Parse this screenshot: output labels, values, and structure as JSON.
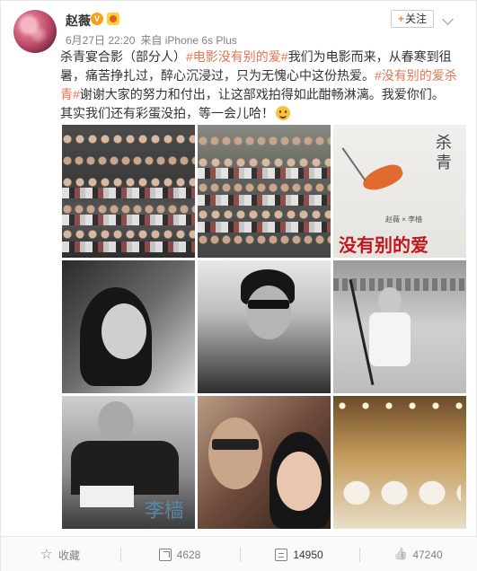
{
  "author": {
    "name": "赵薇",
    "post_time": "6月27日 22:20",
    "source": "来自 iPhone 6s Plus"
  },
  "follow_label": "关注",
  "post": {
    "text_1": "杀青宴合影（部分人）",
    "topic_1": "#电影没有别的爱#",
    "text_2": "我们为电影而来，从春寒到徂暑，痛苦挣扎过，醉心沉浸过，只为无愧心中这份热爱。",
    "topic_2": "#没有别的爱杀青#",
    "text_3": "谢谢大家的努力和付出，让这部戏拍得如此酣畅淋漓。我爱你们。",
    "text_4": "其实我们还有彩蛋没拍，等一会儿哈！"
  },
  "photos": {
    "poster_title": "杀青",
    "poster_credit": "赵薇 × 李樯",
    "poster_movie_title": "没有别的爱",
    "portrait_watermark": "李樯"
  },
  "actions": {
    "favorite_label": "收藏",
    "share_count": "4628",
    "comment_count": "14950",
    "like_count": "47240"
  }
}
